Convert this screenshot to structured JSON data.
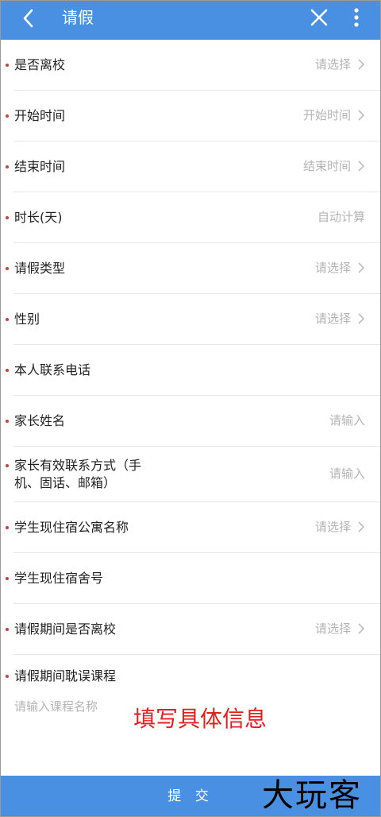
{
  "header": {
    "title": "请假",
    "icons": [
      "chevron-left-icon",
      "close-icon",
      "more-vertical-icon"
    ]
  },
  "colors": {
    "accent": "#4a90e2",
    "required_dot": "#d13a3a",
    "placeholder": "#b4b4b4",
    "note": "#e02020"
  },
  "form": {
    "rows": [
      {
        "label": "是否离校",
        "value": "请选择",
        "chevron": true
      },
      {
        "label": "开始时间",
        "value": "开始时间",
        "chevron": true
      },
      {
        "label": "结束时间",
        "value": "结束时间",
        "chevron": true
      },
      {
        "label": "时长(天)",
        "value": "自动计算",
        "chevron": false
      },
      {
        "label": "请假类型",
        "value": "请选择",
        "chevron": true
      },
      {
        "label": "性别",
        "value": "请选择",
        "chevron": true
      },
      {
        "label": "本人联系电话",
        "value": "",
        "chevron": false
      },
      {
        "label": "家长姓名",
        "value": "请输入",
        "chevron": false
      },
      {
        "label": "家长有效联系方式（手机、固话、邮箱）",
        "label_line1": "家长有效联系方式（手",
        "label_line2": "机、固话、邮箱）",
        "value": "请输入",
        "chevron": false
      },
      {
        "label": "学生现住宿公寓名称",
        "value": "请选择",
        "chevron": true
      },
      {
        "label": "学生现住宿舍号",
        "value": "",
        "chevron": false
      },
      {
        "label": "请假期间是否离校",
        "value": "请选择",
        "chevron": true
      },
      {
        "label": "请假期间耽误课程",
        "value": "",
        "chevron": false
      }
    ],
    "course_placeholder": "请输入课程名称"
  },
  "annotation": "填写具体信息",
  "submit_label": "提 交",
  "watermark": "大玩客"
}
